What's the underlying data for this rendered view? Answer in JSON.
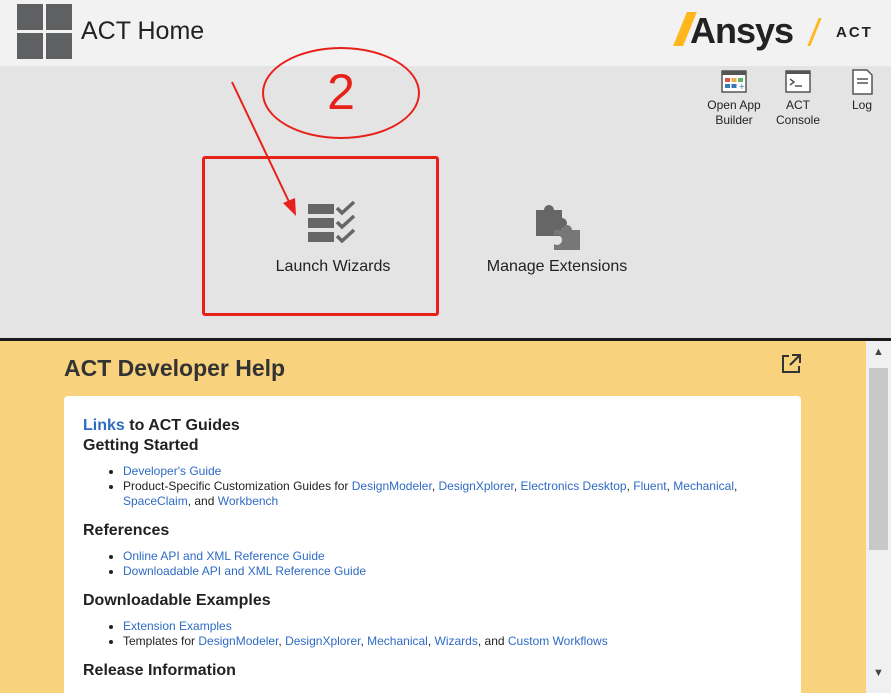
{
  "header": {
    "title": "ACT Home",
    "brand_name": "Ansys",
    "brand_product": "ACT"
  },
  "toolbar": {
    "items": [
      {
        "label_line1": "Open App",
        "label_line2": "Builder",
        "icon": "app-builder-icon"
      },
      {
        "label_line1": "ACT",
        "label_line2": "Console",
        "icon": "console-icon"
      },
      {
        "label_line1": "Log",
        "label_line2": "",
        "icon": "log-icon"
      }
    ]
  },
  "main_actions": {
    "launch_wizards": "Launch Wizards",
    "manage_extensions": "Manage Extensions"
  },
  "annotation": {
    "number": "2",
    "color": "#e8201a"
  },
  "help": {
    "title": "ACT Developer Help",
    "links_word": "Links",
    "links_rest": " to ACT Guides",
    "getting_started": {
      "heading": "Getting Started",
      "developers_guide": "Developer's Guide",
      "product_prefix": "Product-Specific Customization Guides for ",
      "products": [
        "DesignModeler",
        "DesignXplorer",
        "Electronics Desktop",
        "Fluent",
        "Mechanical",
        "SpaceClaim"
      ],
      "and_text": ", and ",
      "workbench": "Workbench"
    },
    "references": {
      "heading": "References",
      "items": [
        "Online API and XML Reference Guide",
        "Downloadable API and XML Reference Guide"
      ]
    },
    "examples": {
      "heading": "Downloadable Examples",
      "extension_examples": "Extension Examples",
      "templates_prefix": "Templates for ",
      "templates": [
        "DesignModeler",
        "DesignXplorer",
        "Mechanical",
        "Wizards"
      ],
      "and_text": ", and ",
      "custom_workflows": "Custom Workflows"
    },
    "release": {
      "heading": "Release Information"
    }
  },
  "colors": {
    "accent": "#ffb71b",
    "help_bg": "#f8d27d",
    "link": "#2e6bc4"
  }
}
